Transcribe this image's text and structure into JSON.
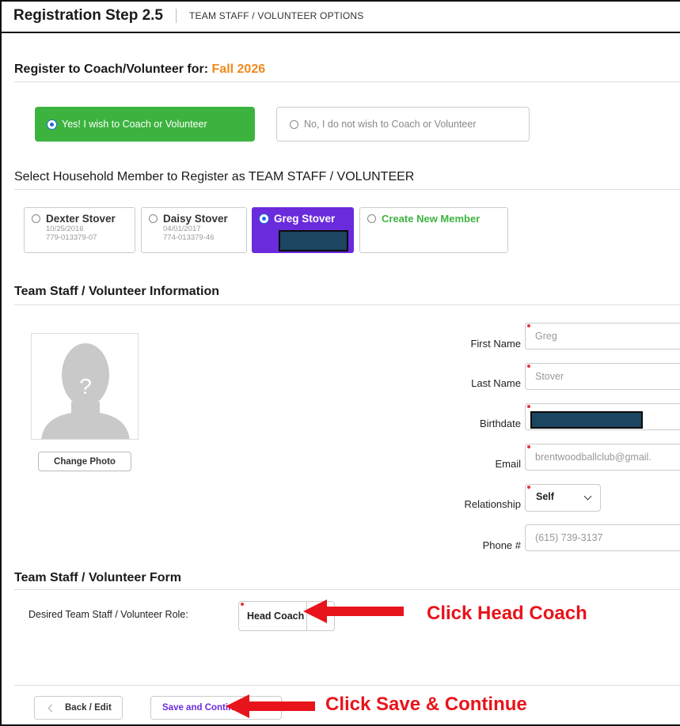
{
  "header": {
    "title": "Registration Step 2.5",
    "subtitle": "TEAM STAFF / VOLUNTEER OPTIONS"
  },
  "register_section": {
    "prefix": "Register to Coach/Volunteer for:",
    "season": "Fall 2026",
    "yes_label": "Yes! I wish to Coach or Volunteer",
    "no_label": "No, I do not wish to Coach or Volunteer"
  },
  "household_section": {
    "title": "Select Household Member to Register as TEAM STAFF / VOLUNTEER",
    "members": [
      {
        "name": "Dexter Stover",
        "dob": "10/25/2016",
        "id": "779-013379-07"
      },
      {
        "name": "Daisy Stover",
        "dob": "04/01/2017",
        "id": "774-013379-46"
      },
      {
        "name": "Greg Stover"
      }
    ],
    "create_label": "Create New Member"
  },
  "info_section": {
    "title": "Team Staff / Volunteer Information",
    "change_photo": "Change Photo",
    "photo_placeholder": "?",
    "fields": {
      "first_name_label": "First Name",
      "first_name_value": "Greg",
      "last_name_label": "Last Name",
      "last_name_value": "Stover",
      "birthdate_label": "Birthdate",
      "email_label": "Email",
      "email_value": "brentwoodballclub@gmail.",
      "relationship_label": "Relationship",
      "relationship_value": "Self",
      "phone_label": "Phone #",
      "phone_value": "(615) 739-3137"
    }
  },
  "form_section": {
    "title": "Team Staff / Volunteer Form",
    "role_label": "Desired Team Staff / Volunteer Role:",
    "role_value": "Head Coach"
  },
  "footer": {
    "back_label": "Back / Edit",
    "save_label": "Save and Continue"
  },
  "annotations": {
    "click_head_coach": "Click Head Coach",
    "click_save": "Click Save & Continue"
  },
  "colors": {
    "accent_green": "#3cb33f",
    "accent_purple": "#6a2bdc",
    "season_orange": "#f08a1a",
    "annotation_red": "#e8141b"
  }
}
